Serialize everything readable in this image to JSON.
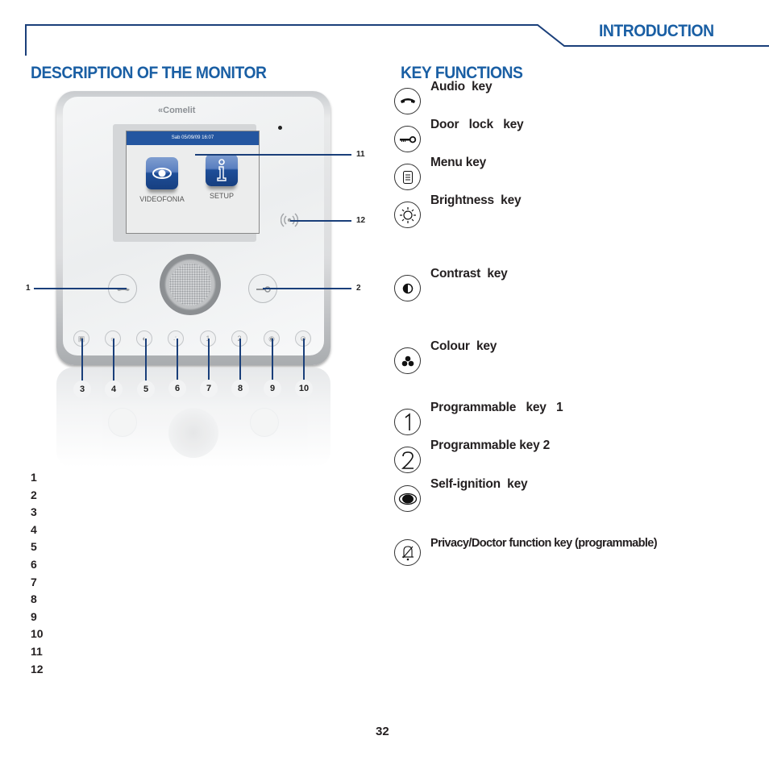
{
  "header": {
    "section": "INTRODUCTION",
    "accent_color": "#1a5fa4",
    "frame_color": "#1a3f7a"
  },
  "left": {
    "title": "DESCRIPTION OF THE MONITOR",
    "monitor": {
      "brand": "Comelit",
      "screen": {
        "status_bar": "Sab 05/09/09 16:07",
        "apps": [
          {
            "label": "VIDEOFONIA",
            "icon": "eye-icon"
          },
          {
            "label": "SETUP",
            "icon": "info-icon"
          }
        ]
      },
      "callouts": {
        "side": [
          "1",
          "2",
          "11",
          "12"
        ],
        "bottom": [
          "3",
          "4",
          "5",
          "6",
          "7",
          "8",
          "9",
          "10"
        ]
      },
      "small_keys": [
        "menu-icon",
        "brightness-icon",
        "contrast-icon",
        "colour-icon",
        "1",
        "2",
        "self-ignition-icon",
        "privacy-icon"
      ]
    },
    "numbered_list": [
      "1",
      "2",
      "3",
      "4",
      "5",
      "6",
      "7",
      "8",
      "9",
      "10",
      "11",
      "12"
    ]
  },
  "right": {
    "title": "KEY FUNCTIONS",
    "keys": [
      {
        "icon": "handset-icon",
        "label": "Audio  key"
      },
      {
        "icon": "key-icon",
        "label": "Door   lock   key"
      },
      {
        "icon": "menu-icon",
        "label": "Menu key"
      },
      {
        "icon": "brightness-icon",
        "label": "Brightness  key"
      },
      {
        "icon": "contrast-icon",
        "label": "Contrast  key"
      },
      {
        "icon": "colour-icon",
        "label": "Colour  key"
      },
      {
        "icon": "number-one-icon",
        "label": "Programmable   key   1"
      },
      {
        "icon": "number-two-icon",
        "label": "Programmable key 2"
      },
      {
        "icon": "eye-icon",
        "label": "Self-ignition  key"
      },
      {
        "icon": "bell-off-icon",
        "label": "Privacy/Doctor function key (programmable)"
      }
    ]
  },
  "footer": {
    "page_number": "32"
  }
}
